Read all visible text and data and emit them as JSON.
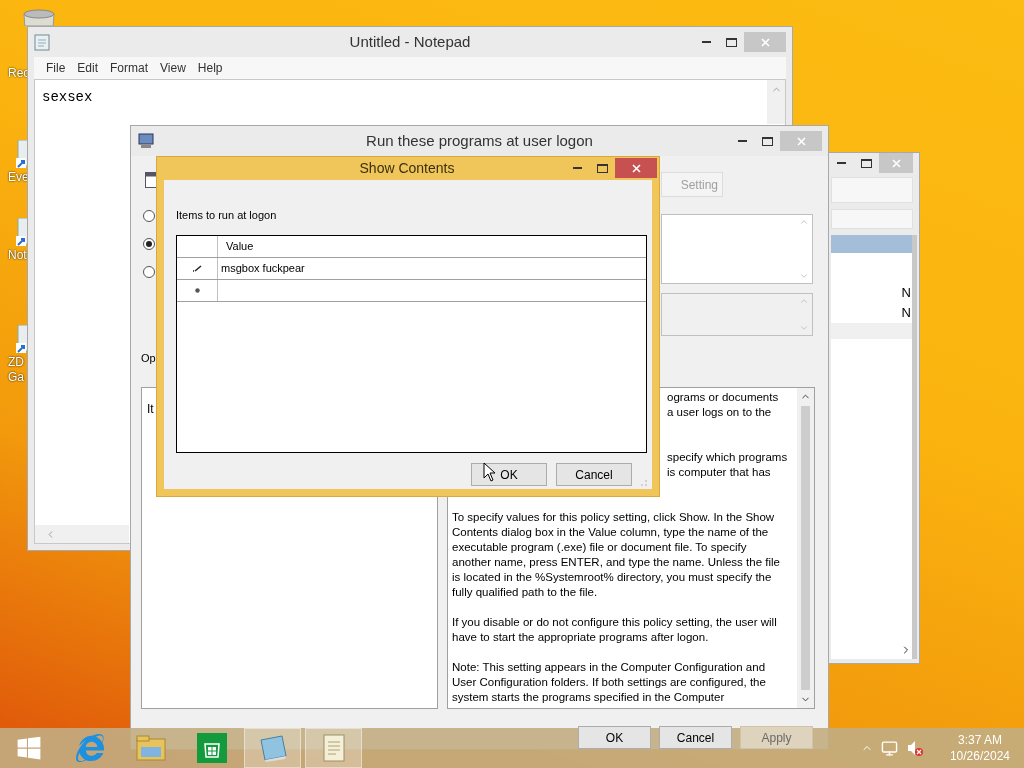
{
  "desktop_icons": [
    {
      "kind": "bin",
      "lines": [
        "Rec"
      ]
    },
    {
      "kind": "shortcut",
      "lines": [
        "Eve"
      ]
    },
    {
      "kind": "shortcut",
      "lines": [
        "Not"
      ]
    },
    {
      "kind": "shortcut",
      "lines": [
        "ZD",
        "Ga"
      ]
    }
  ],
  "notepad": {
    "title": "Untitled - Notepad",
    "active": false,
    "menu": [
      "File",
      "Edit",
      "Format",
      "View",
      "Help"
    ],
    "text": "sexsex"
  },
  "back_window": {
    "active": false,
    "cells": [
      "N",
      "N"
    ]
  },
  "policy_window": {
    "title": "Run these programs at user logon",
    "active": false,
    "setting_button": "Setting",
    "radios": [
      {
        "selected": false
      },
      {
        "selected": true
      },
      {
        "selected": false
      }
    ],
    "options_label": "Op",
    "items_label": "It",
    "help_fragments": [
      [
        "ograms or documents",
        "a user logs on to the"
      ],
      [
        "specify which programs",
        "is computer that has"
      ]
    ],
    "help_paragraphs": [
      "To specify values for this policy setting, click Show. In the Show Contents dialog box in the Value column, type the name of the executable program (.exe) file or document file. To specify another name, press ENTER, and type the name. Unless the file is located in the %Systemroot% directory, you must specify the fully qualified path to the file.",
      "If you disable or do not configure this policy setting, the user will have to start the appropriate programs after logon.",
      "Note: This setting appears in the Computer Configuration and User Configuration folders. If both settings are configured, the system starts the programs specified in the Computer"
    ],
    "buttons": [
      {
        "label": "OK",
        "disabled": false
      },
      {
        "label": "Cancel",
        "disabled": false
      },
      {
        "label": "Apply",
        "disabled": true
      }
    ]
  },
  "dialog": {
    "title": "Show Contents",
    "active": true,
    "label": "Items to run at logon",
    "column": "Value",
    "rows": [
      {
        "kind": "edit",
        "value": "msgbox fuckpear"
      },
      {
        "kind": "new"
      }
    ],
    "buttons": [
      "OK",
      "Cancel"
    ]
  },
  "taskbar": {
    "apps": [
      {
        "kind": "start",
        "active": false
      },
      {
        "kind": "browser",
        "active": false
      },
      {
        "kind": "folder",
        "active": false
      },
      {
        "kind": "store",
        "active": false
      },
      {
        "kind": "notebook",
        "active": true
      },
      {
        "kind": "notepad",
        "active": true
      }
    ],
    "time": "3:37 AM",
    "date": "10/26/2024"
  }
}
